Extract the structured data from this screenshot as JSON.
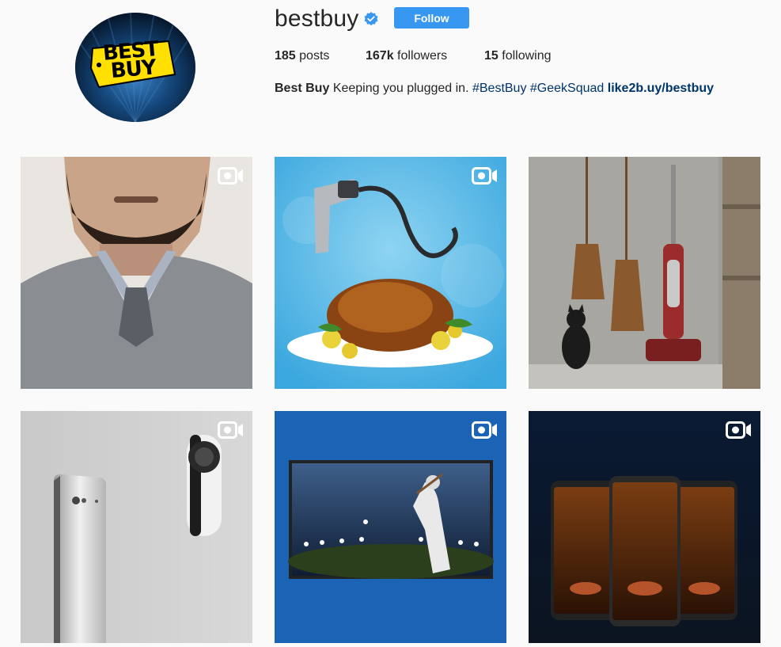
{
  "profile": {
    "username": "bestbuy",
    "follow_label": "Follow",
    "stats": {
      "posts_count": "185",
      "posts_label": "posts",
      "followers_count": "167k",
      "followers_label": "followers",
      "following_count": "15",
      "following_label": "following"
    },
    "bio": {
      "name": "Best Buy",
      "text": "Keeping you plugged in.",
      "hashtag1": "#BestBuy",
      "hashtag2": "#GeekSquad",
      "link": "like2b.uy/bestbuy"
    },
    "logo_text_line1": "BEST",
    "logo_text_line2": "BUY"
  },
  "posts": [
    {
      "subject": "bearded man in grey sweater",
      "icon": "video-camera-icon"
    },
    {
      "subject": "smoking gun over roast turkey",
      "icon": "video-camera-icon"
    },
    {
      "subject": "vacuum cleaner with brooms and black cat",
      "icon": "video-camera-icon"
    },
    {
      "subject": "smartphone with 360 camera",
      "icon": "video-camera-icon"
    },
    {
      "subject": "tv showing baseball stadium",
      "icon": "video-camera-icon"
    },
    {
      "subject": "three phones with oil lamps",
      "icon": "video-camera-icon"
    }
  ],
  "colors": {
    "accent": "#3897f0",
    "link": "#003569",
    "brand_yellow": "#ffe000"
  }
}
